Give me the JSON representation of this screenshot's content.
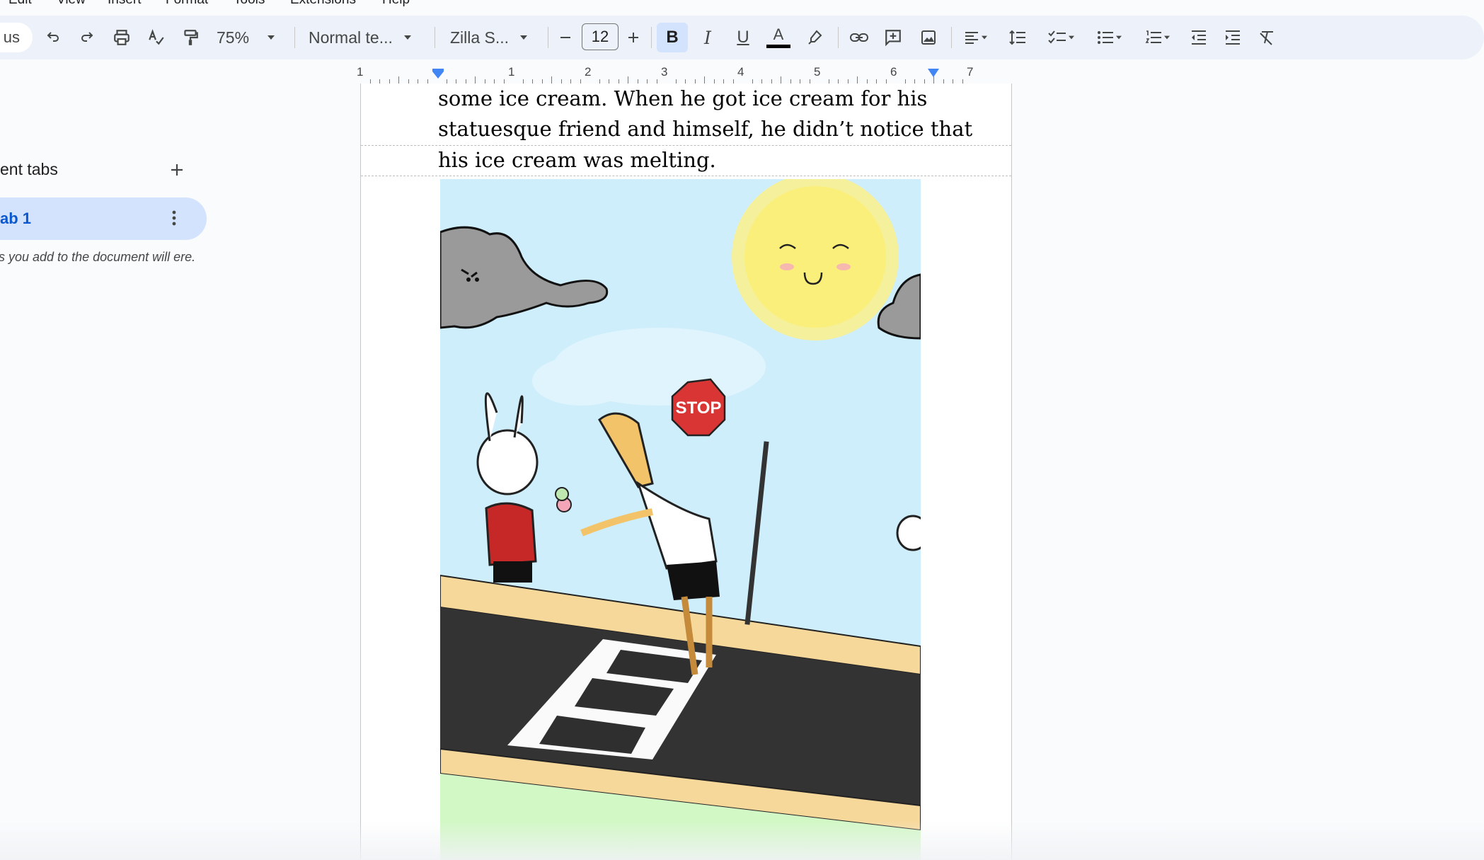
{
  "menu": {
    "items": [
      "Edit",
      "View",
      "Insert",
      "Format",
      "Tools",
      "Extensions",
      "Help"
    ]
  },
  "toolbar": {
    "search_fragment": "us",
    "zoom": "75%",
    "style": "Normal te...",
    "font": "Zilla S...",
    "font_size": "12",
    "bold_label": "B",
    "italic_label": "I",
    "underline_label": "U",
    "text_color_label": "A"
  },
  "ruler": {
    "numbers": [
      "1",
      "1",
      "2",
      "3",
      "4",
      "5",
      "6",
      "7"
    ]
  },
  "sidebar": {
    "title": "ent tabs",
    "tab_label": "ab 1",
    "hint": "s you add to the document will ere."
  },
  "document": {
    "lines": [
      "some ice cream. When he got ice cream for his",
      "statuesque friend and himself, he didn’t notice that",
      "his ice cream was melting."
    ],
    "stop_sign_text": "STOP"
  },
  "colors": {
    "accent": "#0b57d0",
    "toolbar_bg": "#edf2fa",
    "active_bg": "#d3e3fd",
    "sky": "#cfeefc",
    "sun": "#fbf08a",
    "stop_red": "#d93535"
  }
}
